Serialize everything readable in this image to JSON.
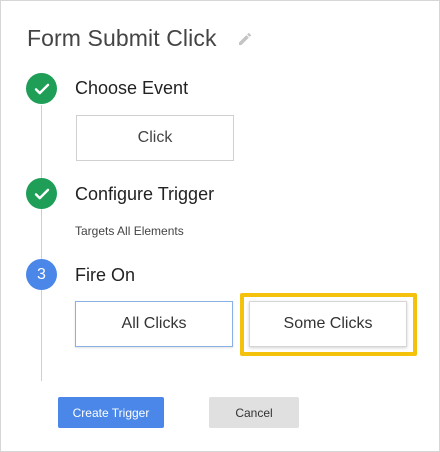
{
  "header": {
    "title": "Form Submit Click",
    "edit_icon": "pencil-icon"
  },
  "steps": [
    {
      "label": "Choose Event",
      "status": "done",
      "icon": "check-icon"
    },
    {
      "label": "Configure Trigger",
      "status": "done",
      "icon": "check-icon"
    },
    {
      "label": "Fire On",
      "status": "current",
      "number": "3"
    }
  ],
  "event": {
    "selected": "Click"
  },
  "configure": {
    "summary": "Targets All Elements"
  },
  "fire_on": {
    "options": [
      "All Clicks",
      "Some Clicks"
    ],
    "highlighted": "Some Clicks"
  },
  "actions": {
    "create_label": "Create Trigger",
    "cancel_label": "Cancel"
  },
  "colors": {
    "done": "#1e9e57",
    "current": "#4a87e8",
    "highlight": "#f4c20d",
    "primary_button": "#4a87e8"
  }
}
